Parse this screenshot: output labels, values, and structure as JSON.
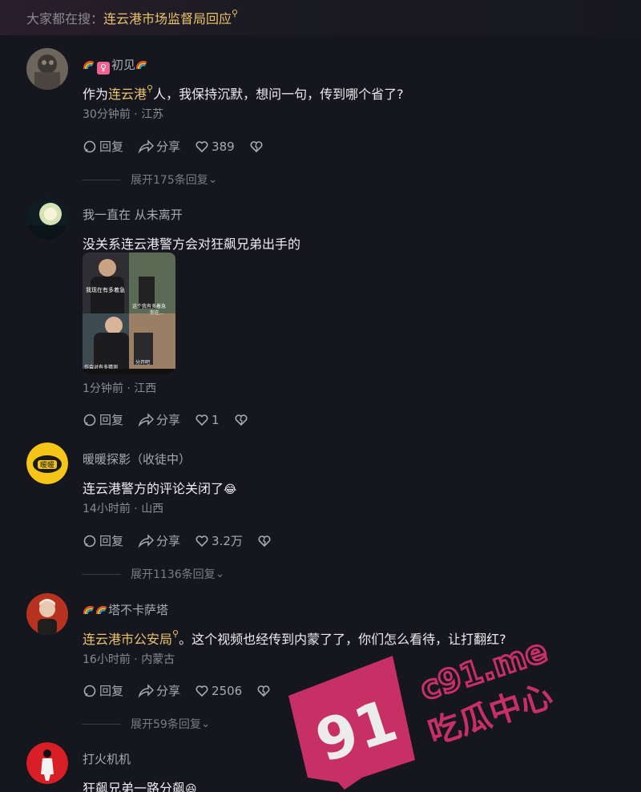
{
  "search_bar": {
    "label": "大家都在搜：",
    "term": "连云港市场监督局回应",
    "icon": "search-icon"
  },
  "comments": [
    {
      "username": "初见",
      "badges": [
        "rainbow-icon",
        "female-icon",
        "rainbow-icon"
      ],
      "text_prefix": "作为",
      "text_link": "连云港",
      "text_suffix": "人，我保持沉默，想问一句，传到哪个省了?",
      "time": "30分钟前",
      "location": "江苏",
      "reply_label": "回复",
      "share_label": "分享",
      "likes": "389",
      "expand_label": "展开175条回复"
    },
    {
      "username": "我一直在 从未离开",
      "text": "没关系连云港警方会对狂飙兄弟出手的",
      "image_captions": [
        "我现在有多着急",
        "这个我有多着急",
        "你在...",
        "作会对有多猜测",
        "分开吧"
      ],
      "time": "1分钟前",
      "location": "江西",
      "reply_label": "回复",
      "share_label": "分享",
      "likes": "1"
    },
    {
      "username": "暖暖探影（收徒中）",
      "avatar_text": "暖暖",
      "text": "连云港警方的评论关闭了",
      "emoji": "😂",
      "time": "14小时前",
      "location": "山西",
      "reply_label": "回复",
      "share_label": "分享",
      "likes": "3.2万",
      "expand_label": "展开1136条回复"
    },
    {
      "username": "塔不卡萨塔",
      "badges": [
        "rainbow-icon",
        "rainbow-icon"
      ],
      "text_link": "连云港市公安局",
      "text_suffix": "。这个视频也经传到内蒙了了，你们怎么看待，让打翻红?",
      "time": "16小时前",
      "location": "内蒙古",
      "reply_label": "回复",
      "share_label": "分享",
      "likes": "2506",
      "expand_label": "展开59条回复"
    },
    {
      "username": "打火机机",
      "text": "狂飙兄弟一路分飙",
      "emoji": "😆"
    }
  ],
  "watermark": {
    "number": "91",
    "domain": "c91.me",
    "tagline": "吃瓜中心"
  },
  "colors": {
    "background": "#16161e",
    "link": "#e9c46a",
    "meta": "#8a8a93",
    "watermark": "#d6336c"
  }
}
